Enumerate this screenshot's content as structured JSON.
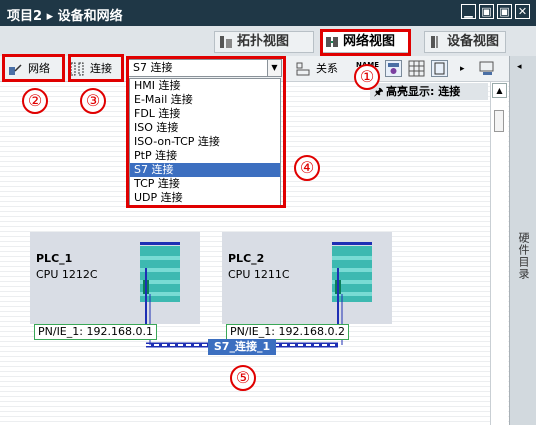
{
  "title_bar": {
    "breadcrumb": "项目2 ▸ 设备和网络",
    "buttons": [
      "▁",
      "▣",
      "▣",
      "✕"
    ]
  },
  "view_tabs": [
    {
      "label": "拓扑视图",
      "icon": "topology-icon",
      "active": false
    },
    {
      "label": "网络视图",
      "icon": "network-view-icon",
      "active": true
    },
    {
      "label": "设备视图",
      "icon": "device-view-icon",
      "active": false
    }
  ],
  "toolbar": {
    "network_label": "网络",
    "connections_label": "连接",
    "connection_type": "S7 连接",
    "relations_label": "关系",
    "name_icon_text": "NAME"
  },
  "connection_types": [
    "HMI 连接",
    "E-Mail 连接",
    "FDL 连接",
    "ISO 连接",
    "ISO-on-TCP 连接",
    "PtP 连接",
    "S7 连接",
    "TCP 连接",
    "UDP 连接"
  ],
  "selected_connection_type": "S7 连接",
  "highlight": {
    "text": "高亮显示: 连接"
  },
  "side_panel": {
    "label": "硬件目录"
  },
  "devices": [
    {
      "name": "PLC_1",
      "cpu": "CPU 1212C",
      "address": "PN/IE_1:  192.168.0.1"
    },
    {
      "name": "PLC_2",
      "cpu": "CPU 1211C",
      "address": "PN/IE_1:  192.168.0.2"
    }
  ],
  "connection": {
    "label": "S7_连接_1"
  },
  "annotations": [
    "①",
    "②",
    "③",
    "④",
    "⑤"
  ],
  "colors": {
    "annotation": "#e00000",
    "selection": "#3c6fc0",
    "module": "#3db9b1",
    "address_border": "#3aa757"
  }
}
